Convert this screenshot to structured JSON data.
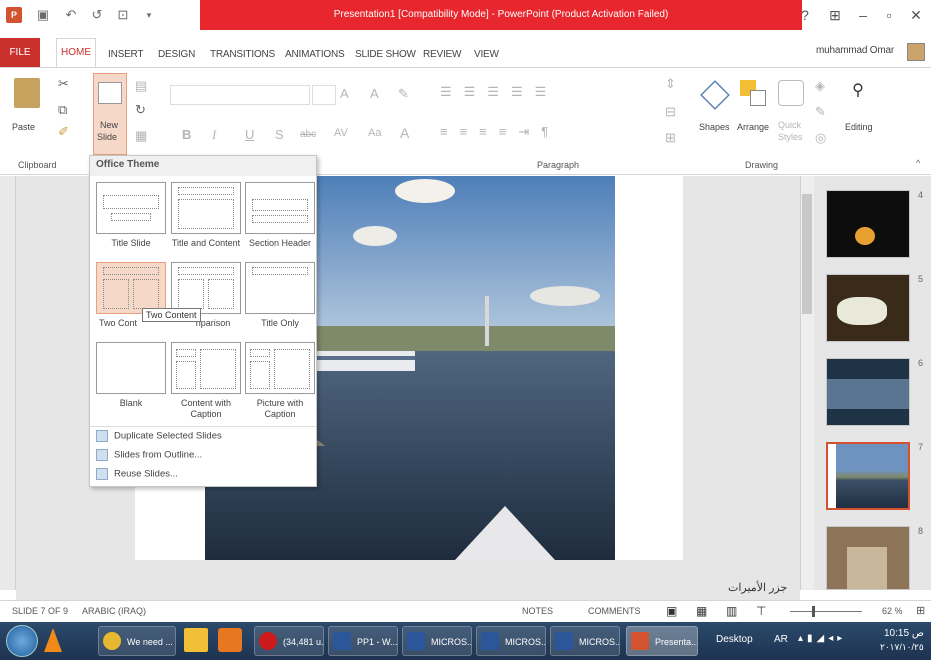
{
  "window": {
    "title": "Presentation1 [Compatibility Mode] - PowerPoint (Product Activation Failed)",
    "user": "muhammad Omar"
  },
  "qat": [
    "ppt-icon",
    "save-icon",
    "undo-icon",
    "redo-icon",
    "present-icon"
  ],
  "tabs": {
    "file": "FILE",
    "home": "HOME",
    "insert": "INSERT",
    "design": "DESIGN",
    "transitions": "TRANSITIONS",
    "animations": "ANIMATIONS",
    "slideshow": "SLIDE SHOW",
    "review": "REVIEW",
    "view": "VIEW"
  },
  "ribbon": {
    "paste": "Paste",
    "new_slide": "New",
    "new_slide2": "Slide",
    "clipboard": "Clipboard",
    "paragraph": "Paragraph",
    "drawing": "Drawing",
    "editing": "Editing",
    "shapes": "Shapes",
    "arrange": "Arrange",
    "quick": "Quick",
    "styles": "Styles",
    "font_b": "B",
    "font_i": "I",
    "font_u": "U",
    "font_s": "S",
    "font_abc": "abc",
    "font_av": "AV",
    "font_aa": "Aa",
    "font_a": "A",
    "font_grow": "A",
    "font_shrink": "A"
  },
  "dropdown": {
    "header": "Office Theme",
    "layouts": [
      {
        "label": "Title Slide"
      },
      {
        "label": "Title and Content"
      },
      {
        "label": "Section Header"
      },
      {
        "label": "Two Content"
      },
      {
        "label": "Comparison"
      },
      {
        "label": "Title Only"
      },
      {
        "label": "Blank"
      },
      {
        "label": "Content with Caption"
      },
      {
        "label": "Picture with Caption"
      }
    ],
    "two_content_visible": "Two Cont",
    "comparison_visible": "nparison",
    "tooltip": "Two Content",
    "commands": [
      "Duplicate Selected Slides",
      "Slides from Outline...",
      "Reuse Slides..."
    ]
  },
  "slides": {
    "numbers": [
      "4",
      "5",
      "6",
      "7",
      "8"
    ],
    "selected": "7"
  },
  "notes_text": "جزر الأميرات",
  "status": {
    "slide": "SLIDE 7 OF 9",
    "language": "ARABIC (IRAQ)",
    "notes": "NOTES",
    "comments": "COMMENTS",
    "zoom": "62 %"
  },
  "taskbar": {
    "items": [
      "We need ...",
      "(34,481 u...",
      "PP1 - W...",
      "MICROS...",
      "MICROS...",
      "MICROS...",
      "Presenta..."
    ],
    "desktop": "Desktop",
    "lang": "AR",
    "time": "10:15",
    "ampm": "ص",
    "date": "٢٠١٧/١٠/٢٥"
  },
  "colors": {
    "accent": "#e8262d",
    "file_tab": "#c9302c",
    "selected_layout": "#f6d8c9",
    "selected_thumb_border": "#d35230"
  }
}
